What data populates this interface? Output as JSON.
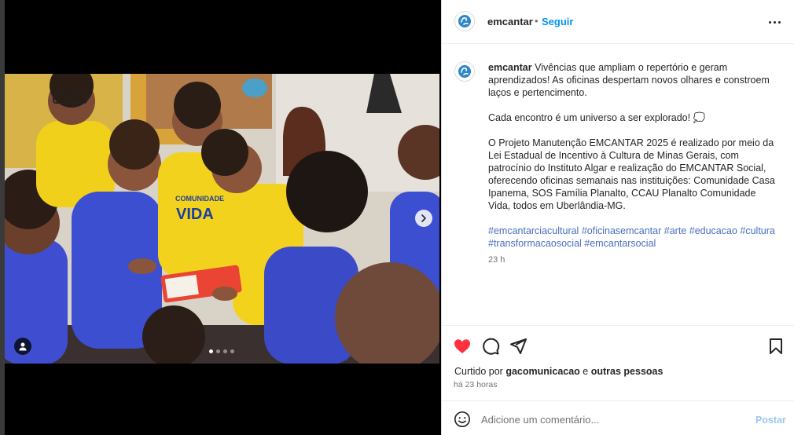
{
  "post": {
    "username": "emcantar",
    "separator": "•",
    "follow_label": "Seguir",
    "caption": {
      "username": "emcantar",
      "paragraph_1": "Vivências que ampliam o repertório e geram aprendizados! As oficinas despertam novos olhares e constroem laços e pertencimento.",
      "paragraph_2": "Cada encontro é um universo a ser explorado! 💭",
      "paragraph_3": "O Projeto Manutenção EMCANTAR 2025 é realizado por meio da Lei Estadual de Incentivo à Cultura de Minas Gerais, com patrocínio do Instituto Algar e realização do EMCANTAR Social, oferecendo oficinas semanais nas instituições: Comunidade Casa Ipanema, SOS Família Planalto, CCAU Planalto Comunidade Vida, todos em Uberlândia-MG.",
      "hashtags": [
        "#emcantarciacultural",
        "#oficinasemcantar",
        "#arte",
        "#educacao",
        "#cultura",
        "#transformacaosocial",
        "#emcantarsocial"
      ],
      "age": "23 h"
    },
    "liked_by": {
      "prefix": "Curtido por",
      "user": "gacomunicacao",
      "suffix": "e",
      "others": "outras pessoas"
    },
    "posted_ago": "há 23 horas",
    "comment": {
      "placeholder": "Adicione um comentário...",
      "value": "",
      "post_label": "Postar"
    },
    "carousel": {
      "current": 1,
      "total": 4
    },
    "photo_text": {
      "shirt_1": "COMUNIDADE",
      "shirt_2": "VIDA"
    },
    "colors": {
      "link": "#0095f6",
      "hashtag": "#4a6fbd",
      "heart": "#ff3040",
      "post_disabled": "#9dc7ee",
      "shirt_yellow": "#f2d21c",
      "shirt_blue": "#3d4fd1"
    },
    "icons": {
      "avatar": "emcantar-logo-icon",
      "like": "heart-filled-icon",
      "comment": "comment-bubble-icon",
      "share": "paper-plane-icon",
      "save": "bookmark-icon",
      "emoji": "smiley-icon",
      "more": "ellipsis-icon",
      "next": "chevron-right-icon",
      "tag": "user-tag-icon"
    }
  }
}
